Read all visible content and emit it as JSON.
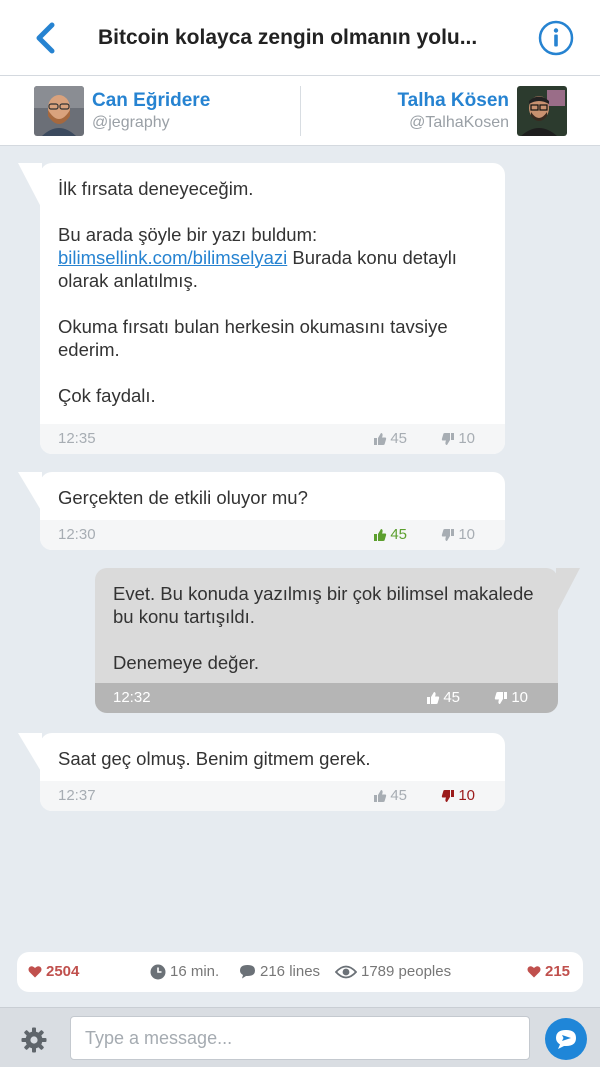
{
  "header": {
    "title": "Bitcoin kolayca zengin olmanın yolu...",
    "back_icon": "chevron-left-icon",
    "info_icon": "info-icon"
  },
  "users": {
    "left": {
      "name": "Can Eğridere",
      "handle": "@jegraphy"
    },
    "right": {
      "name": "Talha Kösen",
      "handle": "@TalhaKosen"
    }
  },
  "messages": [
    {
      "side": "left",
      "paragraphs": [
        "İlk fırsata deneyeceğim."
      ],
      "p2_prefix": "Bu arada şöyle bir yazı buldum:",
      "link": "bilimsellink.com/bilimselyazi",
      "p2_suffix": " Burada konu detaylı olarak anlatılmış.",
      "p3": "Okuma fırsatı bulan herkesin okumasını tavsiye ederim.",
      "p4": "Çok faydalı.",
      "time": "12:35",
      "likes": "45",
      "dislikes": "10",
      "reaction": "none"
    },
    {
      "side": "left",
      "text": "Gerçekten de etkili oluyor mu?",
      "time": "12:30",
      "likes": "45",
      "dislikes": "10",
      "reaction": "liked"
    },
    {
      "side": "right",
      "p1": "Evet. Bu konuda yazılmış bir çok bilimsel makalede bu konu tartışıldı.",
      "p2": "Denemeye değer.",
      "time": "12:32",
      "likes": "45",
      "dislikes": "10",
      "reaction": "none"
    },
    {
      "side": "left",
      "text": "Saat geç olmuş. Benim gitmem gerek.",
      "time": "12:37",
      "likes": "45",
      "dislikes": "10",
      "reaction": "disliked"
    }
  ],
  "stats": {
    "left_hearts": "2504",
    "duration": "16 min.",
    "lines": "216 lines",
    "viewers": "1789 peoples",
    "right_hearts": "215"
  },
  "composer": {
    "placeholder": "Type a message...",
    "value": ""
  },
  "colors": {
    "accent": "#2683d1",
    "liked": "#5c9f2e",
    "disliked": "#9b1b1b",
    "heart": "#c0504d"
  }
}
